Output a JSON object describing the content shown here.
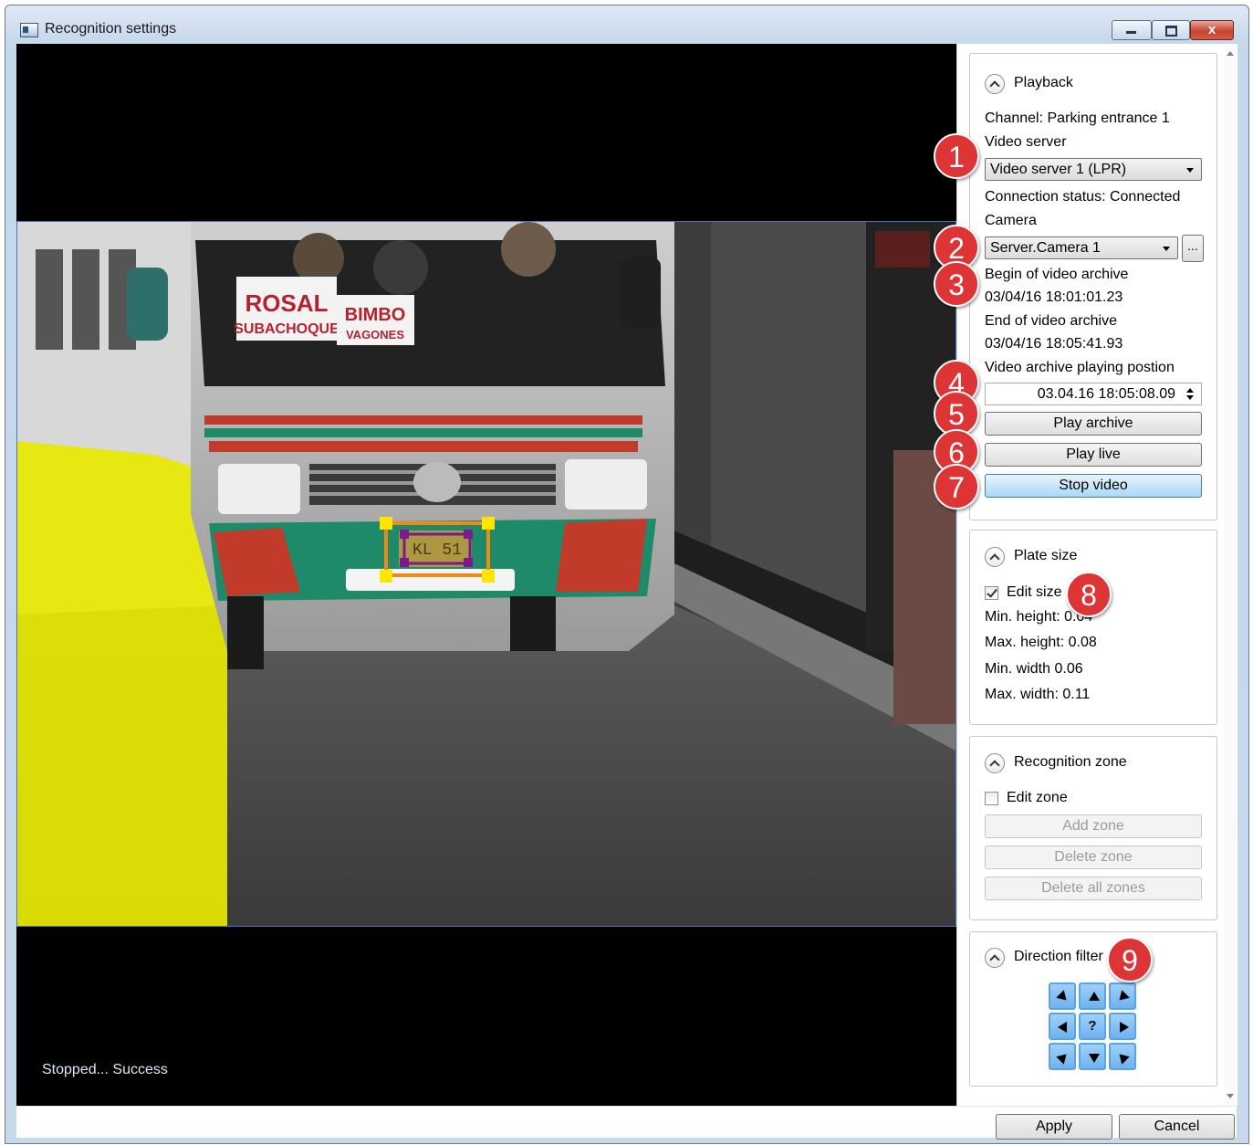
{
  "window": {
    "title": "Recognition settings",
    "minimize_label": "",
    "maximize_label": "",
    "close_label": "x"
  },
  "video": {
    "status": "Stopped... Success",
    "plate_text": "KL 51"
  },
  "playback": {
    "header": "Playback",
    "channel": "Channel: Parking entrance 1",
    "video_server_label": "Video server",
    "video_server_value": "Video server 1 (LPR)",
    "connection_status": "Connection status: Connected",
    "camera_label": "Camera",
    "camera_value": "Server.Camera 1",
    "browse_label": "...",
    "begin_label": "Begin of video archive",
    "begin_value": "03/04/16 18:01:01.23",
    "end_label": "End of video archive",
    "end_value": "03/04/16 18:05:41.93",
    "position_label": "Video archive playing postion",
    "position_value": "03.04.16 18:05:08.09",
    "play_archive": "Play archive",
    "play_live": "Play live",
    "stop_video": "Stop video"
  },
  "plate_size": {
    "header": "Plate size",
    "edit_size_label": "Edit size",
    "edit_size_checked": true,
    "min_height": "Min. height: 0.04",
    "max_height": "Max. height: 0.08",
    "min_width": "Min. width 0.06",
    "max_width": "Max. width: 0.11"
  },
  "recognition_zone": {
    "header": "Recognition zone",
    "edit_zone_label": "Edit zone",
    "edit_zone_checked": false,
    "add_zone": "Add zone",
    "delete_zone": "Delete zone",
    "delete_all_zones": "Delete all zones"
  },
  "direction_filter": {
    "header": "Direction filter",
    "center_label": "?"
  },
  "markers": [
    "1",
    "2",
    "3",
    "4",
    "5",
    "6",
    "7",
    "8",
    "9"
  ],
  "footer": {
    "apply": "Apply",
    "cancel": "Cancel"
  },
  "colors": {
    "accent": "#dd3535",
    "active_button": "#a9d8f7",
    "zone_frame": "#f08a16",
    "zone_handle": "#ffe600",
    "plate_marker": "#7a1a8c"
  }
}
